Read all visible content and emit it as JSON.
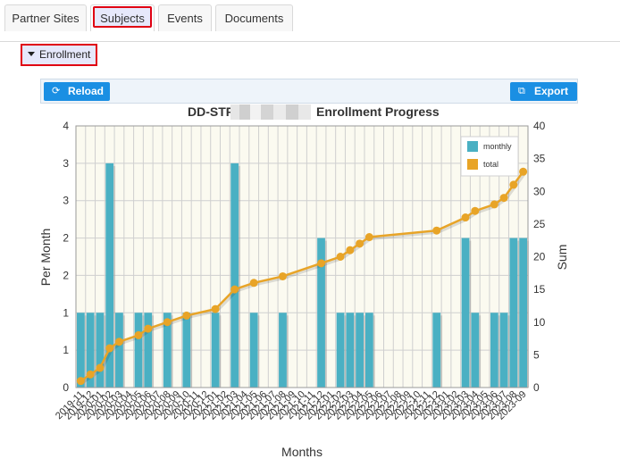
{
  "tabs": [
    {
      "label": "Partner Sites",
      "active": false
    },
    {
      "label": "Subjects",
      "active": true
    },
    {
      "label": "Events",
      "active": false
    },
    {
      "label": "Documents",
      "active": false
    }
  ],
  "section": {
    "label": "Enrollment"
  },
  "toolbar": {
    "reload_label": "Reload",
    "export_label": "Export",
    "reload_icon": "refresh-icon",
    "export_icon": "external-link-icon"
  },
  "colors": {
    "bar": "#4ab0c3",
    "line": "#e8a427",
    "accent": "#1a8fe3",
    "highlight": "#e00012"
  },
  "chart_data": {
    "type": "bar",
    "title_prefix": "DD-STR-",
    "title_suffix": "Enrollment Progress",
    "title_redacted": true,
    "xlabel": "Months",
    "ylabel": "Per Month",
    "y2label": "Sum",
    "y_tick_labels": [
      "0",
      "1",
      "1",
      "2",
      "2",
      "3",
      "3",
      "4"
    ],
    "ylim": [
      0,
      3.5
    ],
    "y2lim": [
      0,
      40
    ],
    "y2_ticks": [
      0,
      5,
      10,
      15,
      20,
      25,
      30,
      35,
      40
    ],
    "grid": true,
    "legend_position": "top-right",
    "categories": [
      "2019-11",
      "2019-12",
      "2020-01",
      "2020-02",
      "2020-03",
      "2020-04",
      "2020-05",
      "2020-06",
      "2020-07",
      "2020-08",
      "2020-09",
      "2020-10",
      "2020-11",
      "2020-12",
      "2021-01",
      "2021-02",
      "2021-03",
      "2021-04",
      "2021-05",
      "2021-06",
      "2021-07",
      "2021-08",
      "2021-09",
      "2021-10",
      "2021-11",
      "2021-12",
      "2022-01",
      "2022-02",
      "2022-03",
      "2022-04",
      "2022-05",
      "2022-06",
      "2022-07",
      "2022-08",
      "2022-09",
      "2022-10",
      "2022-11",
      "2022-12",
      "2023-01",
      "2023-02",
      "2023-03",
      "2023-04",
      "2023-05",
      "2023-06",
      "2023-07",
      "2023-08",
      "2023-09"
    ],
    "series": [
      {
        "name": "monthly",
        "type": "bar",
        "values": [
          1,
          1,
          1,
          3,
          1,
          0,
          1,
          1,
          0,
          1,
          0,
          1,
          0,
          0,
          1,
          0,
          3,
          0,
          1,
          0,
          0,
          1,
          0,
          0,
          0,
          2,
          0,
          1,
          1,
          1,
          1,
          0,
          0,
          0,
          0,
          0,
          0,
          1,
          0,
          0,
          2,
          1,
          0,
          1,
          1,
          2,
          2
        ]
      },
      {
        "name": "total",
        "type": "line",
        "values": [
          1,
          2,
          3,
          6,
          7,
          null,
          8,
          9,
          null,
          10,
          null,
          11,
          null,
          null,
          12,
          null,
          15,
          null,
          16,
          null,
          null,
          17,
          null,
          null,
          null,
          19,
          null,
          20,
          21,
          22,
          23,
          null,
          null,
          null,
          null,
          null,
          null,
          24,
          null,
          null,
          26,
          27,
          null,
          28,
          29,
          31,
          33
        ]
      }
    ]
  }
}
